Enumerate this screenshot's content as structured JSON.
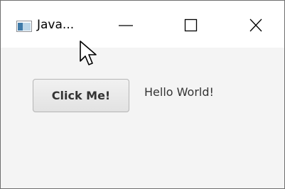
{
  "window": {
    "title": "Java...",
    "icon": "java-app-icon",
    "controls": {
      "minimize_icon": "minimize-icon",
      "maximize_icon": "maximize-icon",
      "close_icon": "close-icon"
    }
  },
  "content": {
    "button_label": "Click Me!",
    "label_text": "Hello World!"
  },
  "colors": {
    "titlebar_bg": "#ffffff",
    "content_bg": "#f4f4f4",
    "text": "#333333",
    "button_border": "#b5b5b5"
  }
}
